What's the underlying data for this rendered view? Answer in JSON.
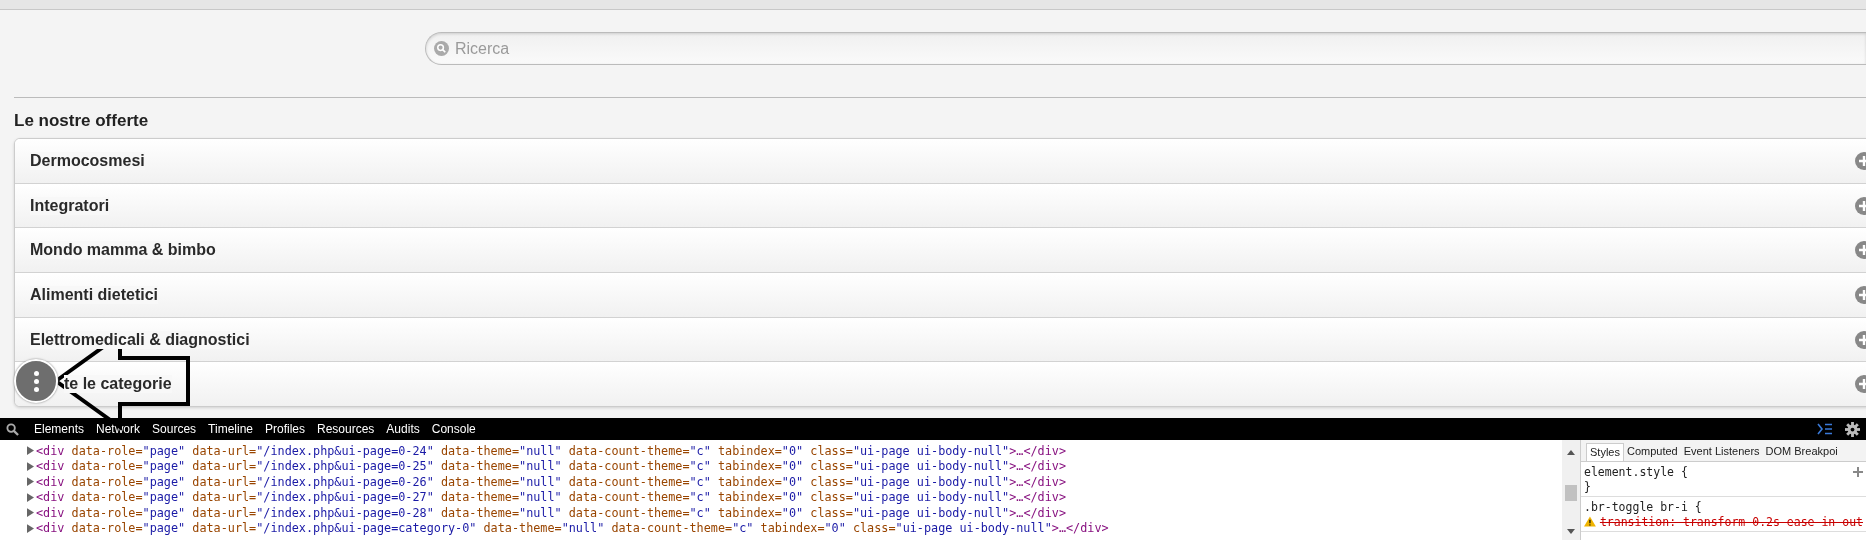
{
  "search": {
    "placeholder": "Ricerca"
  },
  "section_title": "Le nostre offerte",
  "categories": [
    {
      "label": "Dermocosmesi"
    },
    {
      "label": "Integratori"
    },
    {
      "label": "Mondo mamma & bimbo"
    },
    {
      "label": "Alimenti dietetici"
    },
    {
      "label": "Elettromedicali & diagnostici"
    },
    {
      "label": "te le categorie"
    }
  ],
  "devtools": {
    "tabs": [
      {
        "label": "Elements",
        "selected": false
      },
      {
        "label": "Network",
        "selected": false
      },
      {
        "label": "Sources",
        "selected": false
      },
      {
        "label": "Timeline",
        "selected": false
      },
      {
        "label": "Profiles",
        "selected": false
      },
      {
        "label": "Resources",
        "selected": false
      },
      {
        "label": "Audits",
        "selected": false
      },
      {
        "label": "Console",
        "selected": false
      }
    ],
    "code_lines": [
      "<div data-role=\"page\" data-url=\"/index.php&ui-page=0-24\" data-theme=\"null\" data-count-theme=\"c\" tabindex=\"0\" class=\"ui-page ui-body-null\">…</div>",
      "<div data-role=\"page\" data-url=\"/index.php&ui-page=0-25\" data-theme=\"null\" data-count-theme=\"c\" tabindex=\"0\" class=\"ui-page ui-body-null\">…</div>",
      "<div data-role=\"page\" data-url=\"/index.php&ui-page=0-26\" data-theme=\"null\" data-count-theme=\"c\" tabindex=\"0\" class=\"ui-page ui-body-null\">…</div>",
      "<div data-role=\"page\" data-url=\"/index.php&ui-page=0-27\" data-theme=\"null\" data-count-theme=\"c\" tabindex=\"0\" class=\"ui-page ui-body-null\">…</div>",
      "<div data-role=\"page\" data-url=\"/index.php&ui-page=0-28\" data-theme=\"null\" data-count-theme=\"c\" tabindex=\"0\" class=\"ui-page ui-body-null\">…</div>",
      "<div data-role=\"page\" data-url=\"/index.php&ui-page=category-0\" data-theme=\"null\" data-count-theme=\"c\" tabindex=\"0\" class=\"ui-page ui-body-null\">…</div>"
    ],
    "styles_tabs": [
      {
        "label": "Styles",
        "selected": true
      },
      {
        "label": "Computed",
        "selected": false
      },
      {
        "label": "Event Listeners",
        "selected": false
      },
      {
        "label": "DOM Breakpoi",
        "selected": false
      }
    ],
    "rules": [
      {
        "selector": "element.style {",
        "close": "}"
      },
      {
        "selector": ".br-toggle br-i {",
        "overridden": "transition: transform 0.2s ease-in-out"
      }
    ]
  }
}
